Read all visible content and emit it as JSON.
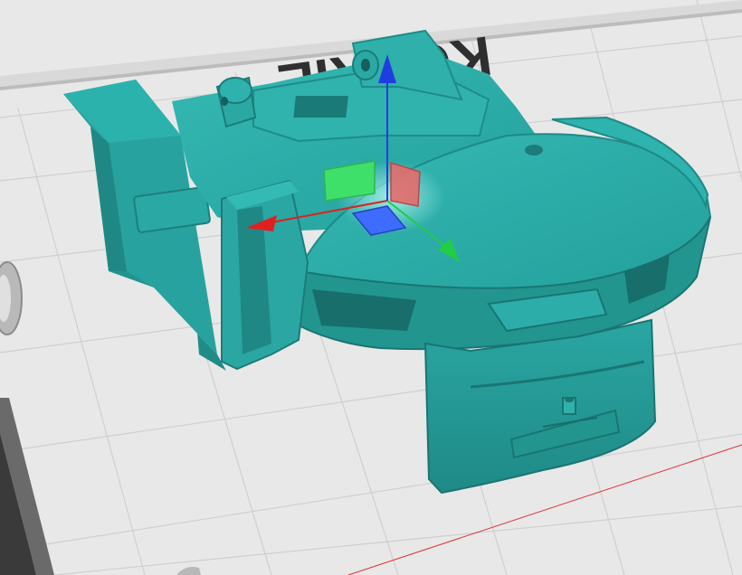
{
  "viewport": {
    "bed_text": "KCURIE",
    "background_color": "#e8e8e8",
    "grid_color": "#cfcfcf",
    "model_color": "#2aa8a4",
    "model_shadow_color": "#1b7d7a"
  },
  "gizmo": {
    "x_axis_color": "#e02020",
    "y_axis_color": "#22cc44",
    "z_axis_color": "#1e3fe0",
    "xy_plane_color": "#3d6cff",
    "xz_plane_color": "#e36b6b",
    "yz_plane_color": "#3fe06a"
  }
}
